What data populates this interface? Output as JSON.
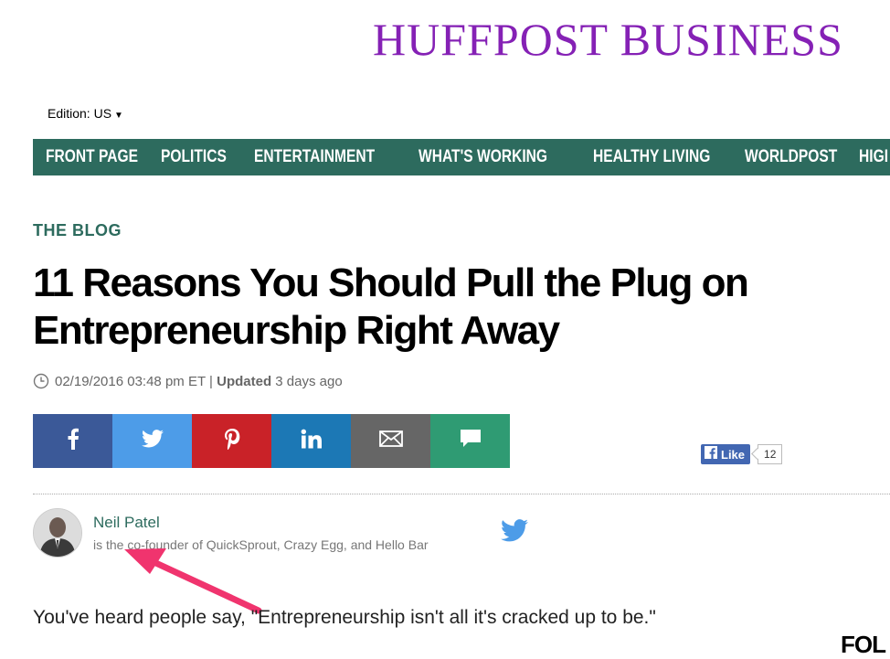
{
  "brand": "HUFFPOST BUSINESS",
  "edition": {
    "label": "Edition: US"
  },
  "nav": {
    "items": [
      "FRONT PAGE",
      "POLITICS",
      "ENTERTAINMENT",
      "WHAT'S WORKING",
      "HEALTHY LIVING",
      "WORLDPOST",
      "HIGI"
    ]
  },
  "article": {
    "section": "THE BLOG",
    "title": "11 Reasons You Should Pull the Plug on Entrepreneurship Right Away",
    "date": "02/19/2016 03:48 pm ET",
    "separator": "|",
    "updated_label": "Updated",
    "updated_value": "3 days ago",
    "lead": "You've heard people say, \"Entrepreneurship isn't all it's cracked up to be.\""
  },
  "share": {
    "buttons": [
      {
        "icon": "facebook-icon",
        "color": "#3b5998"
      },
      {
        "icon": "twitter-icon",
        "color": "#4d9ce8"
      },
      {
        "icon": "pinterest-icon",
        "color": "#c92228"
      },
      {
        "icon": "linkedin-icon",
        "color": "#1c78b5"
      },
      {
        "icon": "email-icon",
        "color": "#666666"
      },
      {
        "icon": "comment-icon",
        "color": "#2f9b73"
      }
    ],
    "like_label": "Like",
    "like_count": "12"
  },
  "author": {
    "name": "Neil Patel",
    "bio": "is the co-founder of QuickSprout, Crazy Egg, and Hello Bar"
  },
  "follow_label": "FOL",
  "colors": {
    "brand": "#8521b5",
    "nav_bg": "#2d6b5e",
    "annotation_arrow": "#f0346e"
  }
}
